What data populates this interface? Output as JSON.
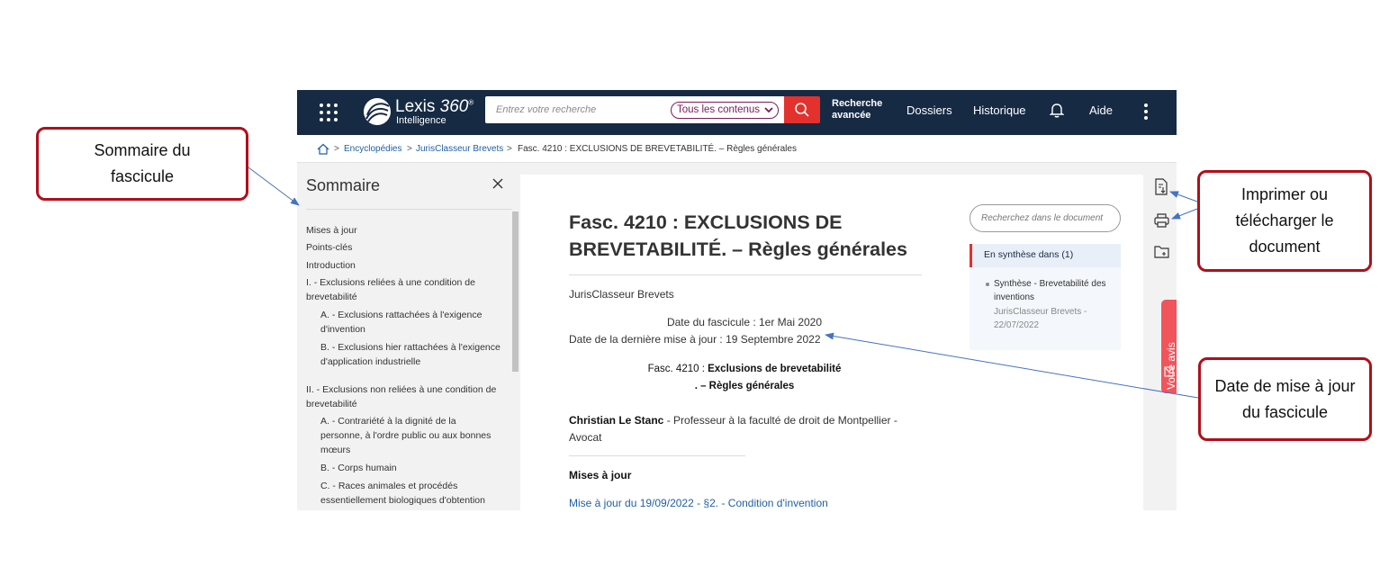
{
  "header": {
    "logo": {
      "name": "Lexis",
      "version": "360",
      "registered": "®",
      "subtitle": "Intelligence"
    },
    "search": {
      "placeholder": "Entrez votre recherche",
      "value": "",
      "scope": "Tous les contenus"
    },
    "nav": {
      "advanced": "Recherche avancée",
      "folders": "Dossiers",
      "history": "Historique",
      "help": "Aide"
    }
  },
  "breadcrumb": [
    {
      "label": "Encyclopédies"
    },
    {
      "label": "JurisClasseur Brevets"
    },
    {
      "label": "Fasc. 4210 : EXCLUSIONS DE BREVETABILITÉ. – Règles générales"
    }
  ],
  "sidebar": {
    "title": "Sommaire",
    "items": [
      {
        "label": "Mises à jour"
      },
      {
        "label": "Points-clés"
      },
      {
        "label": "Introduction"
      },
      {
        "label": "I. - Exclusions reliées à une condition de brevetabilité"
      },
      {
        "label": "A. - Exclusions rattachées à l'exigence d'invention"
      },
      {
        "label": "B. - Exclusions hier rattachées à l'exigence d'application industrielle"
      },
      {
        "label": "II. - Exclusions non reliées à une condition de brevetabilité"
      },
      {
        "label": "A. - Contrariété à la dignité de la personne, à l'ordre public ou aux bonnes mœurs"
      },
      {
        "label": "B. - Corps humain"
      },
      {
        "label": "C. - Races animales et procédés essentiellement biologiques d'obtention"
      }
    ]
  },
  "document": {
    "title": "Fasc. 4210 : EXCLUSIONS DE BREVETABILITÉ. – Règles générales",
    "source": "JurisClasseur Brevets",
    "date_fascicule": "Date du fascicule : 1er Mai 2020",
    "date_update": "Date de la dernière mise à jour : 19 Septembre 2022",
    "fasc_prefix": "Fasc. 4210 :",
    "fasc_title": "Exclusions de brevetabilité",
    "fasc_sub": ". – Règles générales",
    "author_name": "Christian Le Stanc",
    "author_role": " - Professeur à la faculté de droit de Montpellier - Avocat",
    "mises_heading": "Mises à jour",
    "update_link": "Mise à jour du 19/09/2022 - §2. - Condition d'invention",
    "doc_search_placeholder": "Recherchez dans le document",
    "synthesis": {
      "heading": "En synthèse dans (1)",
      "item": "Synthèse - Brevetabilité des inventions",
      "meta": "JurisClasseur Brevets - 22/07/2022"
    },
    "feedback": "Votre avis"
  },
  "annotations": {
    "sommaire": "Sommaire du fascicule",
    "imprimer": "Imprimer ou télécharger le document",
    "date": "Date de mise à jour du fascicule"
  },
  "colors": {
    "header_bg": "#162a44",
    "accent_red": "#e3312d",
    "link_blue": "#1f5fa8",
    "callout_border": "#b00f1a",
    "scope_purple": "#7b1a5c"
  }
}
